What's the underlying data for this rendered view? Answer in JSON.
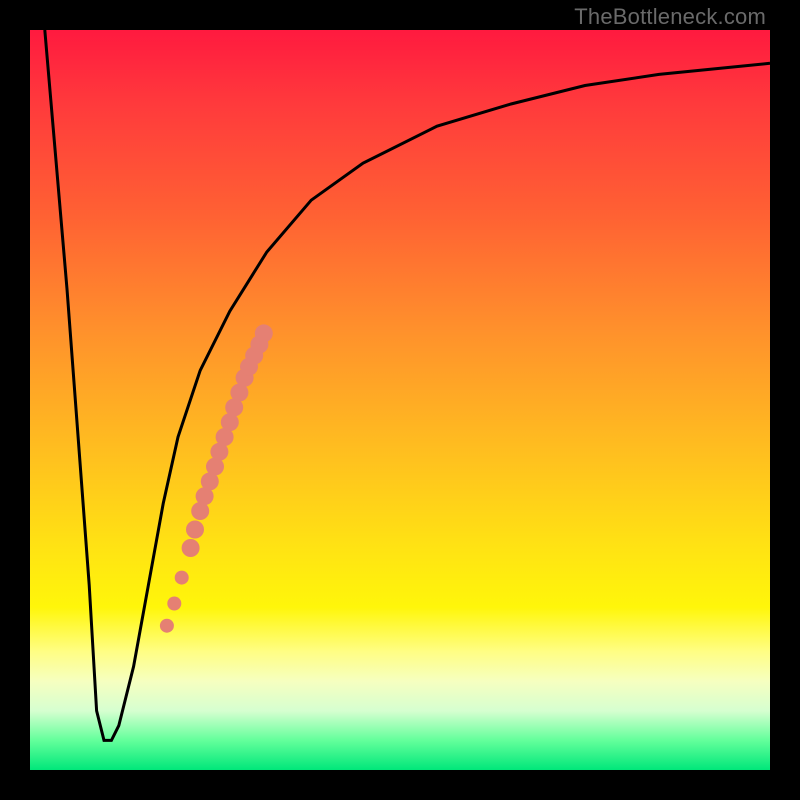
{
  "watermark": "TheBottleneck.com",
  "colors": {
    "curve_stroke": "#000000",
    "dot_fill": "#e58073",
    "gradient_stops": [
      {
        "pos": 0.0,
        "hex": "#ff1a3f"
      },
      {
        "pos": 0.1,
        "hex": "#ff3a3c"
      },
      {
        "pos": 0.25,
        "hex": "#ff6133"
      },
      {
        "pos": 0.4,
        "hex": "#ff8f2c"
      },
      {
        "pos": 0.55,
        "hex": "#ffb921"
      },
      {
        "pos": 0.7,
        "hex": "#ffe313"
      },
      {
        "pos": 0.78,
        "hex": "#fff60a"
      },
      {
        "pos": 0.84,
        "hex": "#fffe84"
      },
      {
        "pos": 0.88,
        "hex": "#f6ffc0"
      },
      {
        "pos": 0.92,
        "hex": "#d6ffd0"
      },
      {
        "pos": 0.96,
        "hex": "#63ff9b"
      },
      {
        "pos": 1.0,
        "hex": "#00e77a"
      }
    ]
  },
  "chart_data": {
    "type": "line",
    "title": "",
    "xlabel": "",
    "ylabel": "",
    "xlim": [
      0,
      100
    ],
    "ylim": [
      0,
      100
    ],
    "series": [
      {
        "name": "bottleneck-curve",
        "x": [
          2,
          5,
          8,
          9,
          10,
          11,
          12,
          14,
          16,
          18,
          20,
          23,
          27,
          32,
          38,
          45,
          55,
          65,
          75,
          85,
          95,
          100
        ],
        "y": [
          100,
          65,
          25,
          8,
          4,
          4,
          6,
          14,
          25,
          36,
          45,
          54,
          62,
          70,
          77,
          82,
          87,
          90,
          92.5,
          94,
          95,
          95.5
        ]
      }
    ],
    "overlay_points": {
      "name": "highlight-dots",
      "x": [
        18.5,
        19.5,
        20.5,
        21.7,
        22.3,
        23.0,
        23.6,
        24.3,
        25.0,
        25.6,
        26.3,
        27.0,
        27.6,
        28.3,
        29.0,
        29.6,
        30.3,
        31.0,
        31.6
      ],
      "y": [
        19.5,
        22.5,
        26.0,
        30.0,
        32.5,
        35.0,
        37.0,
        39.0,
        41.0,
        43.0,
        45.0,
        47.0,
        49.0,
        51.0,
        53.0,
        54.5,
        56.0,
        57.5,
        59.0
      ],
      "r": [
        7,
        7,
        7,
        9,
        9,
        9,
        9,
        9,
        9,
        9,
        9,
        9,
        9,
        9,
        9,
        9,
        9,
        9,
        9
      ]
    }
  }
}
